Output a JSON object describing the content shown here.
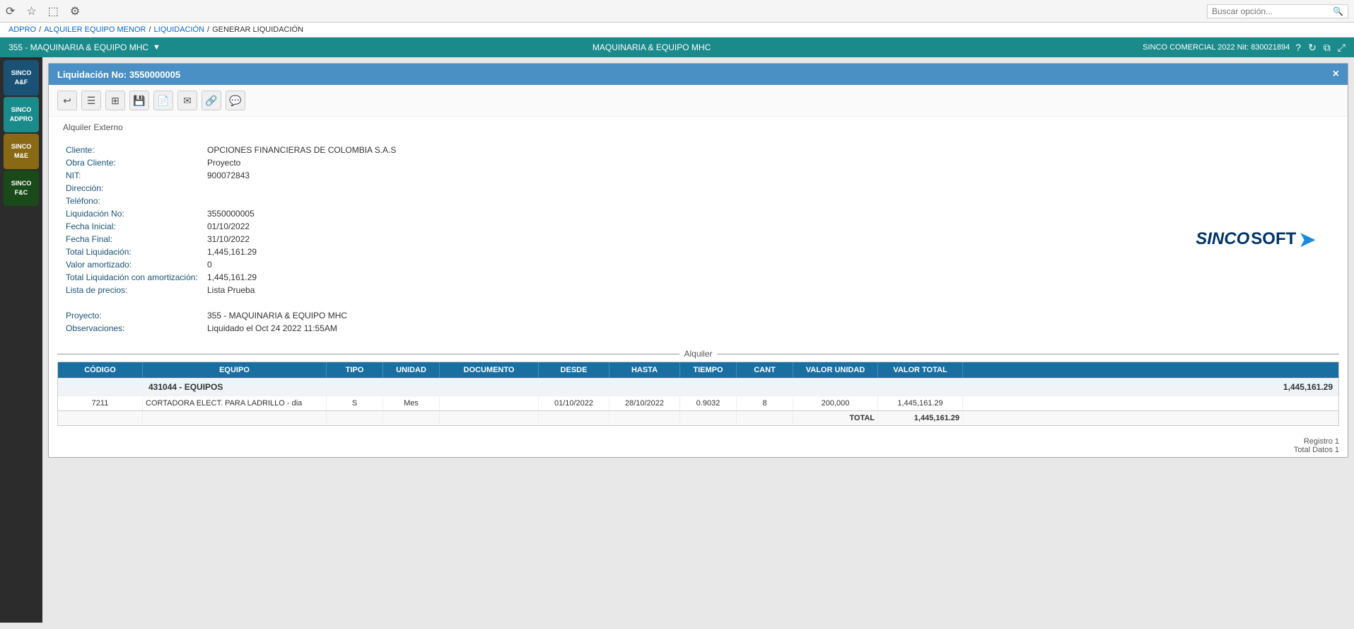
{
  "topbar": {
    "search_placeholder": "Buscar opción...",
    "icons": [
      "undo-icon",
      "star-icon",
      "inbox-icon",
      "settings-icon"
    ]
  },
  "breadcrumb": {
    "items": [
      "ADPRO",
      "ALQUILER EQUIPO MENOR",
      "LIQUIDACIÓN",
      "GENERAR LIQUIDACIÓN"
    ],
    "separators": [
      "/",
      "/",
      "/"
    ]
  },
  "modulebar": {
    "left": "355 - MAQUINARIA & EQUIPO MHC",
    "center": "MAQUINARIA & EQUIPO MHC",
    "right": "SINCO COMERCIAL 2022 Nit: 830021894",
    "icons": [
      "help-icon",
      "refresh-icon",
      "window-icon",
      "expand-icon"
    ]
  },
  "sidebar": {
    "items": [
      {
        "id": "af",
        "line1": "SINCO",
        "line2": "A&F"
      },
      {
        "id": "adpro",
        "line1": "SINCO",
        "line2": "ADPRO"
      },
      {
        "id": "me",
        "line1": "SINCO",
        "line2": "M&E"
      },
      {
        "id": "fc",
        "line1": "SINCO",
        "line2": "F&C"
      }
    ]
  },
  "document": {
    "title": "Liquidación No: 3550000005",
    "section_label": "Alquiler Externo",
    "close_btn": "×"
  },
  "toolbar": {
    "buttons": [
      {
        "name": "back-btn",
        "icon": "↩",
        "label": "Regresar"
      },
      {
        "name": "list-btn",
        "icon": "☰",
        "label": "Lista"
      },
      {
        "name": "grid-btn",
        "icon": "⊞",
        "label": "Grid"
      },
      {
        "name": "save-btn",
        "icon": "💾",
        "label": "Guardar"
      },
      {
        "name": "doc-btn",
        "icon": "📄",
        "label": "Documento"
      },
      {
        "name": "email-btn",
        "icon": "✉",
        "label": "Email"
      },
      {
        "name": "link-btn",
        "icon": "🔗",
        "label": "Enlace"
      },
      {
        "name": "chat-btn",
        "icon": "💬",
        "label": "Chat"
      }
    ]
  },
  "info": {
    "fields": [
      {
        "label": "Cliente:",
        "value": "OPCIONES FINANCIERAS DE COLOMBIA S.A.S"
      },
      {
        "label": "Obra Cliente:",
        "value": "Proyecto"
      },
      {
        "label": "NIT:",
        "value": "900072843"
      },
      {
        "label": "Dirección:",
        "value": ""
      },
      {
        "label": "Teléfono:",
        "value": ""
      },
      {
        "label": "Liquidación No:",
        "value": "3550000005"
      },
      {
        "label": "Fecha Inicial:",
        "value": "01/10/2022"
      },
      {
        "label": "Fecha Final:",
        "value": "31/10/2022"
      },
      {
        "label": "Total Liquidación:",
        "value": "1,445,161.29"
      },
      {
        "label": "Valor amortizado:",
        "value": "0"
      },
      {
        "label": "Total Liquidación con amortización:",
        "value": "1,445,161.29"
      },
      {
        "label": "Lista de precios:",
        "value": "Lista Prueba"
      },
      {
        "label": "",
        "value": ""
      },
      {
        "label": "Proyecto:",
        "value": "355 - MAQUINARIA & EQUIPO MHC"
      },
      {
        "label": "Observaciones:",
        "value": "Liquidado el Oct 24 2022 11:55AM"
      }
    ],
    "logo_text_sinco": "SINCO",
    "logo_text_soft": "SOFT",
    "logo_arrow": "➤"
  },
  "alquiler_section": {
    "label": "Alquiler",
    "table": {
      "columns": [
        "CÓDIGO",
        "EQUIPO",
        "TIPO",
        "UNIDAD",
        "DOCUMENTO",
        "DESDE",
        "HASTA",
        "TIEMPO",
        "CANT",
        "VALOR UNIDAD",
        "VALOR TOTAL"
      ],
      "group_row": "431044 - EQUIPOS",
      "group_total": "1,445,161.29",
      "rows": [
        {
          "codigo": "7211",
          "equipo": "CORTADORA ELECT. PARA LADRILLO - dia",
          "tipo": "S",
          "unidad": "Mes",
          "documento": "",
          "desde": "01/10/2022",
          "hasta": "28/10/2022",
          "tiempo": "0.9032",
          "cant": "8",
          "valor_unidad": "200,000",
          "valor_total": "1,445,161.29"
        }
      ],
      "total_label": "TOTAL",
      "total_value": "1,445,161.29",
      "registro": "Registro 1",
      "total_datos": "Total Datos 1"
    }
  }
}
